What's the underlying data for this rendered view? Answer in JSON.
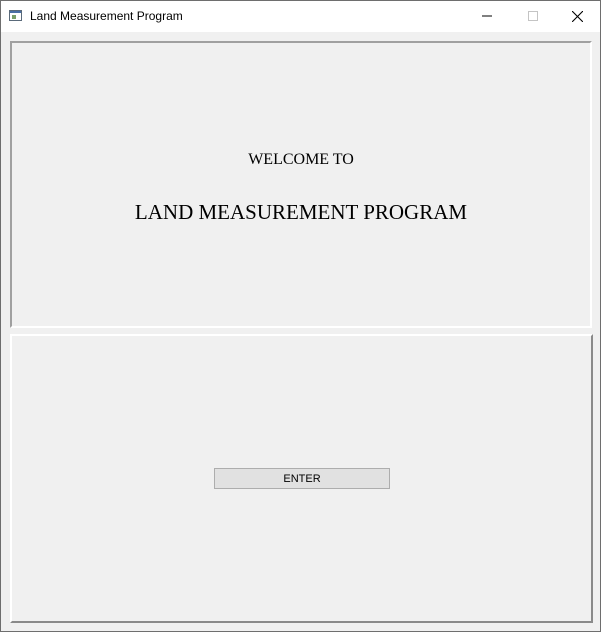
{
  "window": {
    "title": "Land Measurement Program",
    "icons": {
      "app": "window-app-icon",
      "minimize": "minimize-icon",
      "maximize": "maximize-icon",
      "close": "close-icon"
    }
  },
  "welcome": {
    "line1": "WELCOME TO",
    "line2": "LAND MEASUREMENT PROGRAM"
  },
  "actions": {
    "enter_label": "ENTER"
  }
}
